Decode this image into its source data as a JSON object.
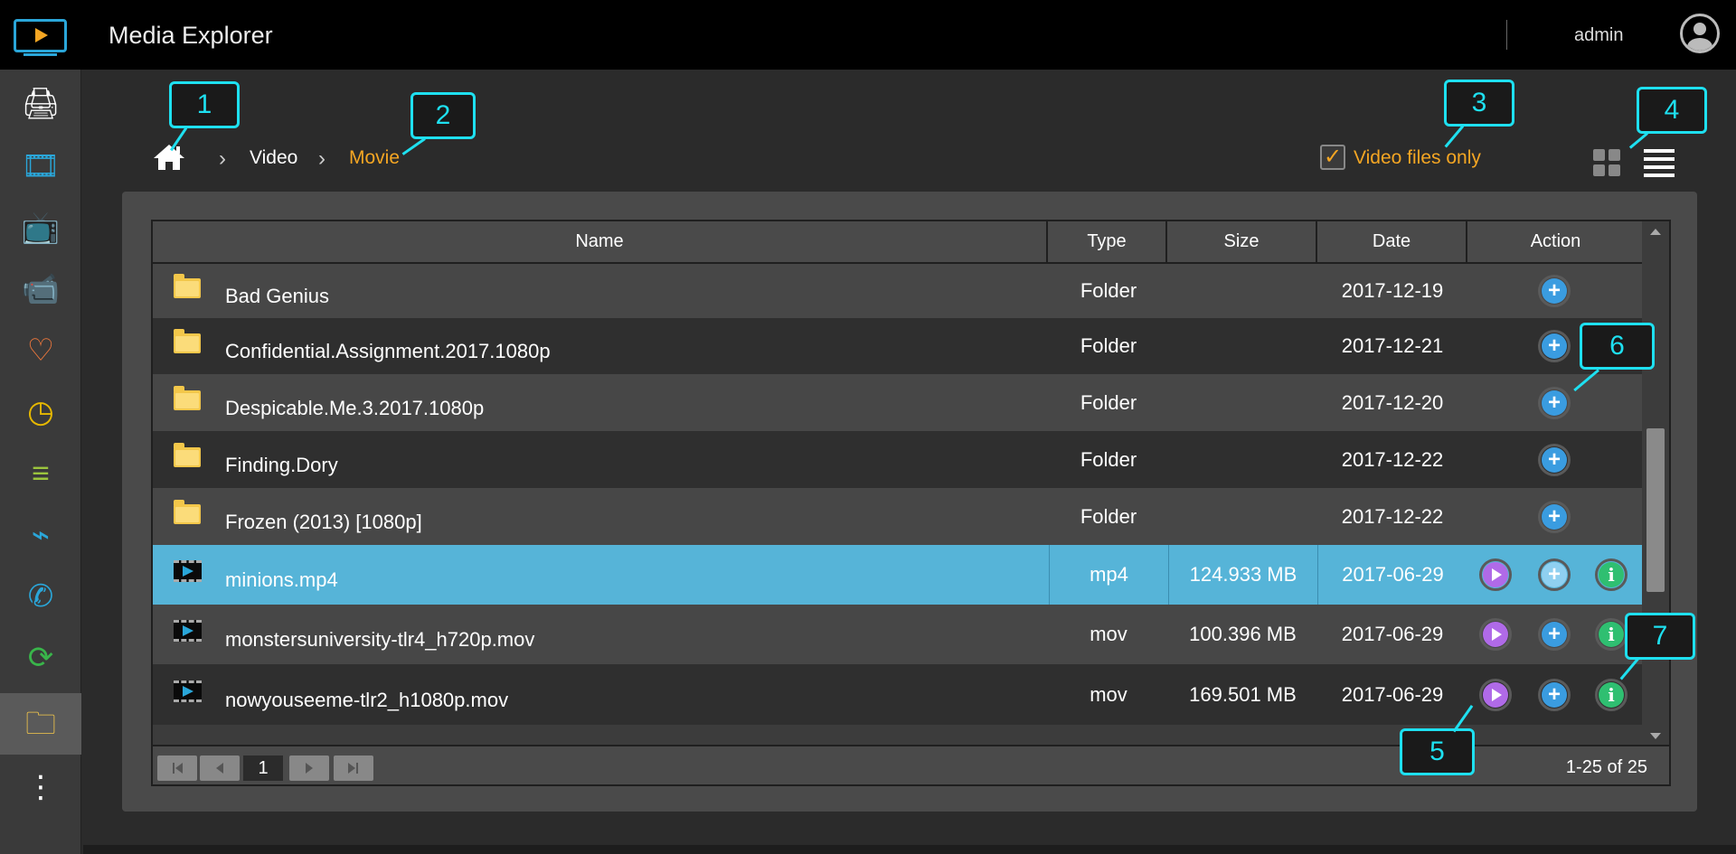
{
  "app": {
    "title": "Media Explorer"
  },
  "user": {
    "name": "admin"
  },
  "sidebar": {
    "items": [
      {
        "name": "nas-icon",
        "glyph": "🖨",
        "color": "#ffffff"
      },
      {
        "name": "film-icon",
        "glyph": "🎞",
        "color": "#2aa6d9"
      },
      {
        "name": "tv-icon",
        "glyph": "📺",
        "color": "#2aa6d9"
      },
      {
        "name": "camcorder-icon",
        "glyph": "📹",
        "color": "#39b54a"
      },
      {
        "name": "heart-icon",
        "glyph": "♡",
        "color": "#f0783c"
      },
      {
        "name": "clock-icon",
        "glyph": "◷",
        "color": "#e6b800"
      },
      {
        "name": "playlist-icon",
        "glyph": "≡",
        "color": "#9bc53d"
      },
      {
        "name": "plug-icon",
        "glyph": "⌁",
        "color": "#2aa6d9"
      },
      {
        "name": "remote-icon",
        "glyph": "✆",
        "color": "#2aa6d9"
      },
      {
        "name": "clapper-icon",
        "glyph": "⟳",
        "color": "#39b54a"
      },
      {
        "name": "folder-video-icon",
        "glyph": "🗀",
        "color": "#f3c74a"
      },
      {
        "name": "more-icon",
        "glyph": "⋮",
        "color": "#ffffff"
      }
    ]
  },
  "breadcrumb": {
    "items": [
      "Video",
      "Movie"
    ]
  },
  "filter": {
    "label": "Video files only",
    "checked": true
  },
  "table": {
    "headers": [
      "Name",
      "Type",
      "Size",
      "Date",
      "Action"
    ],
    "rows": [
      {
        "name": "Bad Genius",
        "type": "Folder",
        "size": "",
        "date": "2017-12-19",
        "kind": "folder"
      },
      {
        "name": "Confidential.Assignment.2017.1080p",
        "type": "Folder",
        "size": "",
        "date": "2017-12-21",
        "kind": "folder"
      },
      {
        "name": "Despicable.Me.3.2017.1080p",
        "type": "Folder",
        "size": "",
        "date": "2017-12-20",
        "kind": "folder"
      },
      {
        "name": "Finding.Dory",
        "type": "Folder",
        "size": "",
        "date": "2017-12-22",
        "kind": "folder"
      },
      {
        "name": "Frozen (2013) [1080p]",
        "type": "Folder",
        "size": "",
        "date": "2017-12-22",
        "kind": "folder"
      },
      {
        "name": "minions.mp4",
        "type": "mp4",
        "size": "124.933 MB",
        "date": "2017-06-29",
        "kind": "video",
        "selected": true
      },
      {
        "name": "monstersuniversity-tlr4_h720p.mov",
        "type": "mov",
        "size": "100.396 MB",
        "date": "2017-06-29",
        "kind": "video"
      },
      {
        "name": "nowyouseeme-tlr2_h1080p.mov",
        "type": "mov",
        "size": "169.501 MB",
        "date": "2017-06-29",
        "kind": "video"
      }
    ]
  },
  "pager": {
    "current_page": "1",
    "count_label": "1-25 of 25"
  },
  "callouts": [
    "1",
    "2",
    "3",
    "4",
    "5",
    "6",
    "7"
  ],
  "colors": {
    "accent": "#f5a623",
    "selected_row": "#56b4d8",
    "callout": "#1ee0f0"
  }
}
